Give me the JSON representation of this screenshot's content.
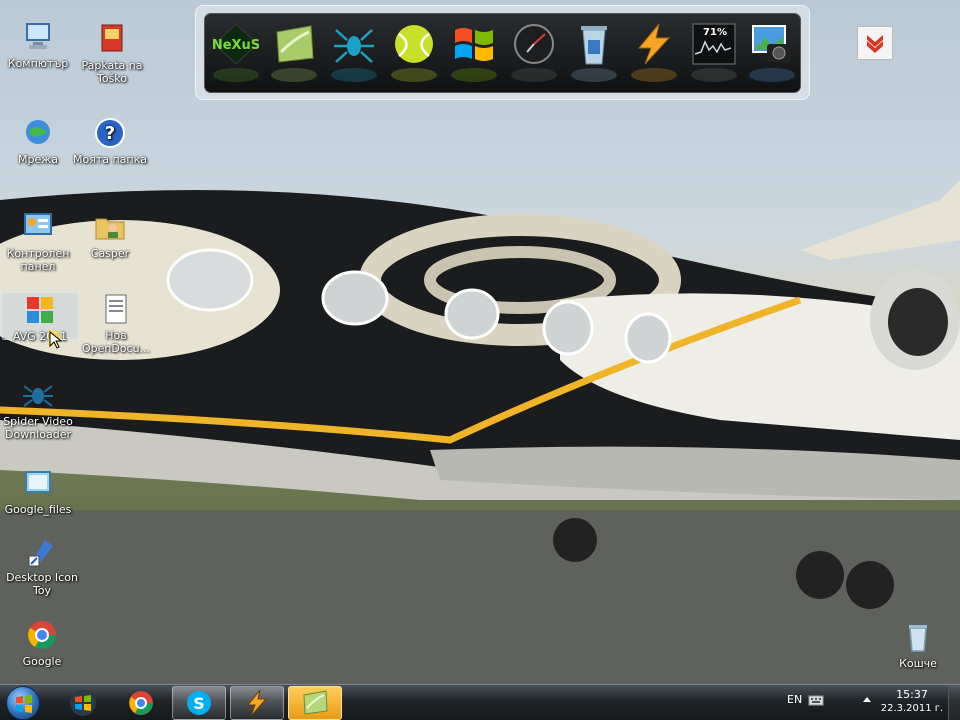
{
  "desktop_icons": [
    {
      "id": "computer",
      "label": "Компютър",
      "icon": "computer-icon"
    },
    {
      "id": "papkata",
      "label": "Papkata na Toško",
      "icon": "folder-app-icon"
    },
    {
      "id": "network",
      "label": "Мрежа",
      "icon": "network-icon"
    },
    {
      "id": "my-folder",
      "label": "Моята папка",
      "icon": "help-icon"
    },
    {
      "id": "control-panel",
      "label": "Контролен панел",
      "icon": "control-panel-icon"
    },
    {
      "id": "casper",
      "label": "Casper",
      "icon": "user-folder-icon"
    },
    {
      "id": "avg",
      "label": "AVG 2011",
      "icon": "avg-icon"
    },
    {
      "id": "new-doc",
      "label": "Нов OpenDocu...",
      "icon": "document-icon"
    },
    {
      "id": "spider",
      "label": "Spider Video Downloader",
      "icon": "spider-icon"
    },
    {
      "id": "google-files",
      "label": "Google_files",
      "icon": "folder-icon"
    },
    {
      "id": "desktop-icon-toy",
      "label": "Desktop Icon Toy",
      "icon": "shortcut-icon"
    },
    {
      "id": "google",
      "label": "Google",
      "icon": "chrome-icon"
    },
    {
      "id": "recycle",
      "label": "Кошче",
      "icon": "recycle-bin-icon"
    }
  ],
  "dock": {
    "items": [
      {
        "id": "nexus",
        "text": "NeXuS",
        "icon": "nexus-logo-icon"
      },
      {
        "id": "leaf",
        "icon": "green-leaf-icon"
      },
      {
        "id": "spider",
        "icon": "spider-icon"
      },
      {
        "id": "tennis",
        "icon": "tennis-ball-icon"
      },
      {
        "id": "windows",
        "icon": "windows-logo-icon"
      },
      {
        "id": "clock",
        "icon": "clock-icon"
      },
      {
        "id": "trash",
        "icon": "trash-icon"
      },
      {
        "id": "winamp",
        "icon": "winamp-bolt-icon"
      },
      {
        "id": "cpu",
        "text": "71%",
        "icon": "cpu-meter-icon"
      },
      {
        "id": "photo",
        "icon": "camera-photo-icon"
      }
    ]
  },
  "taskbar": {
    "buttons": [
      {
        "id": "windows-media",
        "icon": "windows-flag-icon"
      },
      {
        "id": "chrome",
        "icon": "chrome-icon"
      },
      {
        "id": "skype",
        "icon": "skype-icon"
      },
      {
        "id": "winamp",
        "icon": "winamp-bolt-icon"
      },
      {
        "id": "leaf",
        "icon": "green-leaf-icon"
      }
    ],
    "tray": {
      "language": "EN",
      "time": "15:37",
      "date": "22.3.2011 г."
    }
  },
  "colors": {
    "accent_orange": "#f5a623",
    "taskbar_dark": "#1f2428",
    "selection": "#b4c8e6"
  }
}
